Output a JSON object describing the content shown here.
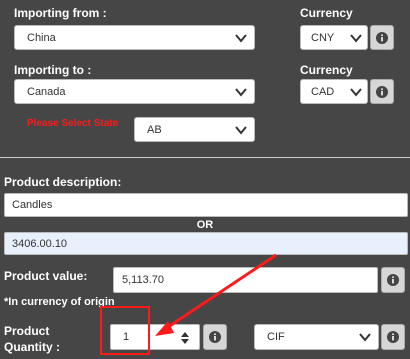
{
  "importing_from": {
    "label": "Importing from :",
    "value": "China"
  },
  "currency_from": {
    "label": "Currency",
    "value": "CNY"
  },
  "importing_to": {
    "label": "Importing to :",
    "value": "Canada"
  },
  "currency_to": {
    "label": "Currency",
    "value": "CAD"
  },
  "state": {
    "label": "Please Select State",
    "value": "AB"
  },
  "product_description": {
    "label": "Product description:",
    "value": "Candles"
  },
  "or_text": "OR",
  "hs_code": {
    "value": "3406.00.10"
  },
  "product_value": {
    "label": "Product value:",
    "value": "5,113.70",
    "note": "*In currency of origin"
  },
  "product_quantity": {
    "label_line1": "Product",
    "label_line2": "Quantity :",
    "value": "1"
  },
  "incoterm": {
    "value": "CIF"
  },
  "colors": {
    "background": "#464646",
    "accent_red": "#ff1a1a",
    "highlight_blue": "#e8f0fe"
  }
}
